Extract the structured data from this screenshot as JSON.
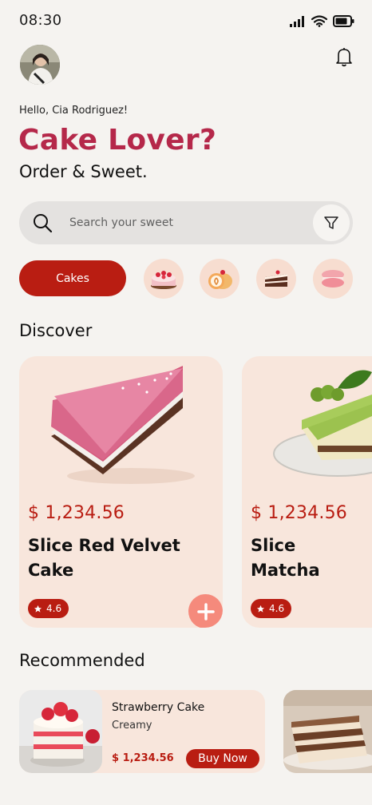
{
  "status": {
    "time": "08:30"
  },
  "header": {
    "greeting": "Hello, Cia Rodriguez!",
    "headline": "Cake Lover?",
    "subheadline": "Order & Sweet."
  },
  "search": {
    "placeholder": "Search your sweet"
  },
  "categories": {
    "active_label": "Cakes",
    "icons": [
      "strawberry-cake-icon",
      "swiss-roll-icon",
      "cake-slice-icon",
      "macaron-icon"
    ]
  },
  "discover": {
    "title": "Discover",
    "items": [
      {
        "price": "$ 1,234.56",
        "name": "Slice Red Velvet Cake",
        "rating": "4.6"
      },
      {
        "price": "$ 1,234.56",
        "name": "Slice Matcha",
        "rating": "4.6"
      }
    ]
  },
  "recommended": {
    "title": "Recommended",
    "items": [
      {
        "name": "Strawberry Cake",
        "subtitle": "Creamy",
        "price": "$ 1,234.56",
        "buy_label": "Buy Now"
      }
    ]
  },
  "colors": {
    "accent": "#b91d12",
    "brand": "#b5284a",
    "card": "#f8e6dc",
    "background": "#f5f3f0"
  }
}
